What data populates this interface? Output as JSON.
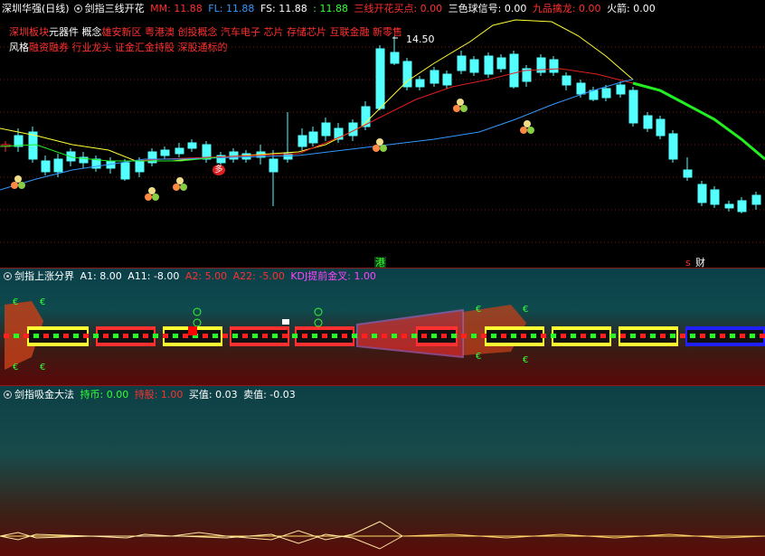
{
  "panel1": {
    "stock_name": "深圳华强(日线)",
    "indicator_name": "剑指三线开花",
    "values": [
      {
        "label": "MM: 11.88",
        "color": "#ff3030"
      },
      {
        "label": "FL: 11.88",
        "color": "#3399ff"
      },
      {
        "label": "FS: 11.88",
        "color": "#ffffff"
      },
      {
        "label": ": 11.88",
        "color": "#33ff33"
      },
      {
        "label": "三线开花买点: 0.00",
        "color": "#ff3030"
      },
      {
        "label": "三色球信号: 0.00",
        "color": "#ffffff"
      },
      {
        "label": "九品擒龙: 0.00",
        "color": "#ff3030"
      },
      {
        "label": "火箭: 0.00",
        "color": "#ffffff"
      }
    ],
    "info_line1_label": "深圳板块",
    "info_line1_sector": "元器件",
    "info_line1_concept_label": "概念",
    "info_line1_concepts": "雄安新区 粤港澳 创投概念 汽车电子 芯片 存储芯片 互联金融 新零售",
    "info_line2_label": "风格",
    "info_line2_styles": "融资融券 行业龙头 证金汇金持股 深股通标的",
    "high_price_label": "14.50",
    "marker_gang": "港",
    "marker_cai": "财",
    "marker_s": "s",
    "marker_duo": "多"
  },
  "panel2": {
    "indicator_name": "剑指上涨分界",
    "values": [
      {
        "label": "A1: 8.00",
        "color": "#ffffff"
      },
      {
        "label": "A11: -8.00",
        "color": "#ffffff"
      },
      {
        "label": "A2: 5.00",
        "color": "#ff3030"
      },
      {
        "label": "A22: -5.00",
        "color": "#ff3030"
      },
      {
        "label": "KDJ提前金叉: 1.00",
        "color": "#ff44ff"
      }
    ]
  },
  "panel3": {
    "indicator_name": "剑指吸金大法",
    "values": [
      {
        "label": "持币: 0.00",
        "color": "#33ff33"
      },
      {
        "label": "持股: 1.00",
        "color": "#ff3030"
      },
      {
        "label": "买值: 0.03",
        "color": "#ffffff"
      },
      {
        "label": "卖值: -0.03",
        "color": "#ffffff"
      }
    ]
  },
  "colors": {
    "up": "#ff3030",
    "down": "#54ffff",
    "ma_yellow": "#ffff33",
    "ma_red": "#e02020",
    "ma_blue": "#3399ff",
    "ma_green": "#22ee22"
  }
}
